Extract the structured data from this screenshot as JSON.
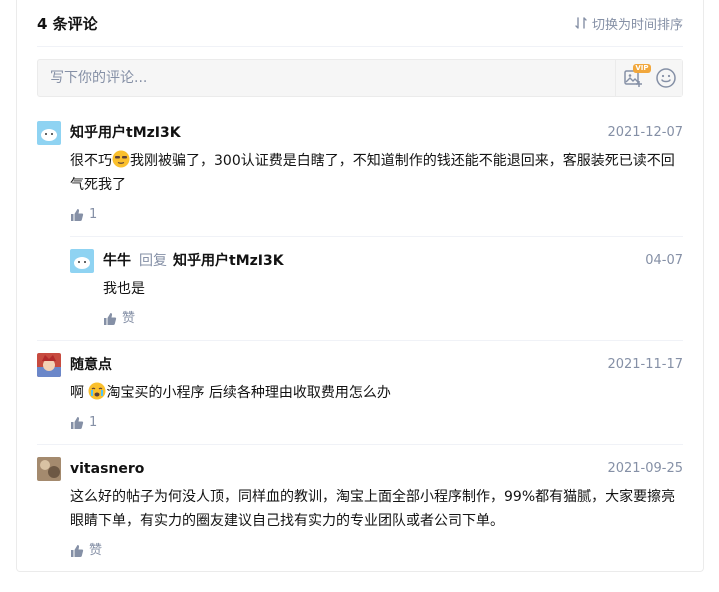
{
  "header": {
    "count": "4 条评论",
    "sort_label": "切换为时间排序"
  },
  "editor": {
    "placeholder": "写下你的评论..."
  },
  "comments": [
    {
      "author": "知乎用户tMzI3K",
      "date": "2021-12-07",
      "text_before_emoji": "很不巧",
      "emoji": "smirk-emoji",
      "text_after_emoji": "我刚被骗了，300认证费是白瞎了，不知道制作的钱还能不能退回来，客服装死已读不回气死我了",
      "likes": "1",
      "replies": [
        {
          "author": "牛牛",
          "reply_word": "回复",
          "reply_to": "知乎用户tMzI3K",
          "date": "04-07",
          "text": "我也是",
          "likes": "赞"
        }
      ]
    },
    {
      "author": "随意点",
      "date": "2021-11-17",
      "text_before_emoji": "啊 ",
      "emoji": "crying-emoji",
      "text_after_emoji": "淘宝买的小程序 后续各种理由收取费用怎么办",
      "likes": "1"
    },
    {
      "author": "vitasnero",
      "date": "2021-09-25",
      "text": "这么好的帖子为何没人顶，同样血的教训，淘宝上面全部小程序制作，99%都有猫腻，大家要擦亮眼睛下单，有实力的圈友建议自己找有实力的专业团队或者公司下单。",
      "likes": "赞"
    }
  ],
  "colors": {
    "muted": "#8590a6",
    "text": "#121212",
    "divider": "#f0f2f7"
  }
}
